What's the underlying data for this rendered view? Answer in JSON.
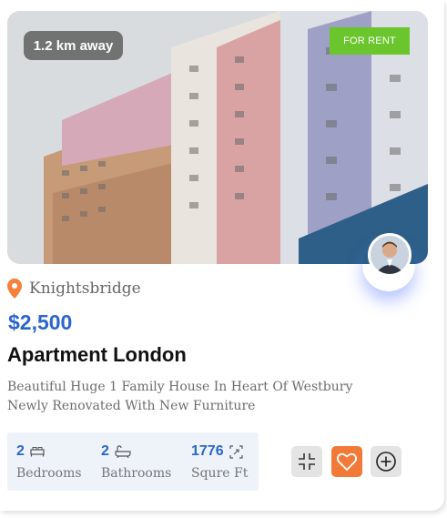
{
  "listing": {
    "distance": "1.2 km away",
    "status_badge": "FOR RENT",
    "location": "Knightsbridge",
    "price": "$2,500",
    "title": "Apartment London",
    "description": "Beautiful Huge 1 Family House In Heart Of Westbury Newly Renovated With New Furniture"
  },
  "stats": [
    {
      "value": "2",
      "label": "Bedrooms",
      "icon": "bed-icon"
    },
    {
      "value": "2",
      "label": "Bathrooms",
      "icon": "bathtub-icon"
    },
    {
      "value": "1776",
      "label": "Squre Ft",
      "icon": "area-icon"
    }
  ],
  "actions": {
    "compare_icon": "compress-icon",
    "favorite_icon": "heart-icon",
    "add_icon": "plus-circle-icon"
  },
  "colors": {
    "price_blue": "#2a66cc",
    "rent_green": "#6ac62c",
    "favorite_orange": "#f27a38",
    "pin_orange": "#f7813a",
    "stats_bg": "#eef3fa"
  }
}
